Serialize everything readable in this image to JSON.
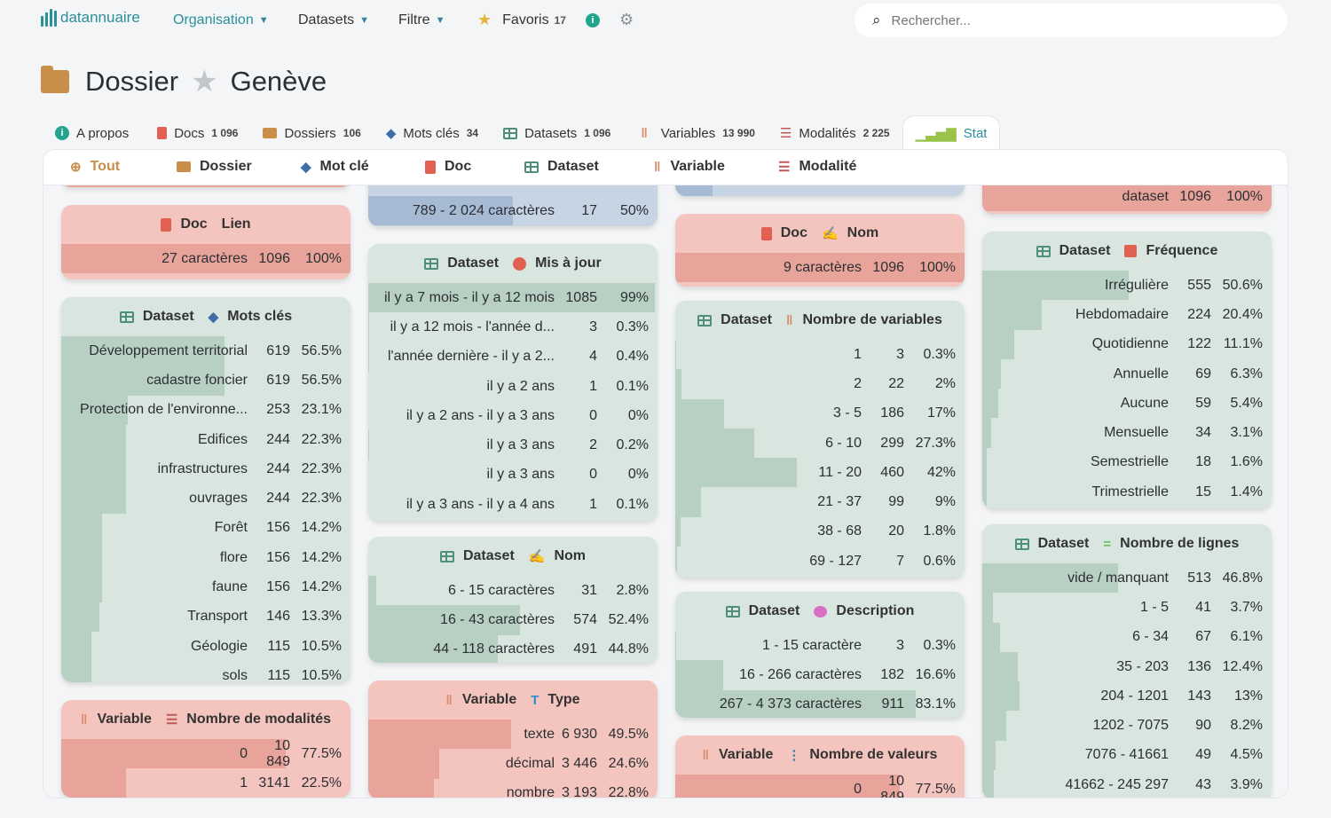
{
  "header": {
    "logo": "datannuaire",
    "nav": [
      {
        "label": "Organisation",
        "active": true
      },
      {
        "label": "Datasets",
        "active": false
      },
      {
        "label": "Filtre",
        "active": false
      }
    ],
    "favoris_label": "Favoris",
    "favoris_count": "17",
    "search_placeholder": "Rechercher..."
  },
  "title": {
    "kind": "Dossier",
    "name": "Genève"
  },
  "tabs": [
    {
      "label": "A propos",
      "count": ""
    },
    {
      "label": "Docs",
      "count": "1 096"
    },
    {
      "label": "Dossiers",
      "count": "106"
    },
    {
      "label": "Mots clés",
      "count": "34"
    },
    {
      "label": "Datasets",
      "count": "1 096"
    },
    {
      "label": "Variables",
      "count": "13 990"
    },
    {
      "label": "Modalités",
      "count": "2 225"
    },
    {
      "label": "Stat",
      "count": ""
    }
  ],
  "filters": [
    "Tout",
    "Dossier",
    "Mot clé",
    "Doc",
    "Dataset",
    "Variable",
    "Modalité"
  ],
  "cards": {
    "c1_top": {
      "rows": [
        {
          "l": "",
          "c": "",
          "p": "",
          "f": 1.0
        }
      ]
    },
    "c1_lien": {
      "h1": "Doc",
      "h2": "Lien",
      "rows": [
        {
          "l": "27 caractères",
          "c": "1096",
          "p": "100%",
          "f": 1.0
        }
      ]
    },
    "c1_mots": {
      "h1": "Dataset",
      "h2": "Mots clés",
      "rows": [
        {
          "l": "Développement territorial",
          "c": "619",
          "p": "56.5%",
          "f": 0.565
        },
        {
          "l": "cadastre foncier",
          "c": "619",
          "p": "56.5%",
          "f": 0.565
        },
        {
          "l": "Protection de l'environne...",
          "c": "253",
          "p": "23.1%",
          "f": 0.231
        },
        {
          "l": "Edifices",
          "c": "244",
          "p": "22.3%",
          "f": 0.223
        },
        {
          "l": "infrastructures",
          "c": "244",
          "p": "22.3%",
          "f": 0.223
        },
        {
          "l": "ouvrages",
          "c": "244",
          "p": "22.3%",
          "f": 0.223
        },
        {
          "l": "Forêt",
          "c": "156",
          "p": "14.2%",
          "f": 0.142
        },
        {
          "l": "flore",
          "c": "156",
          "p": "14.2%",
          "f": 0.142
        },
        {
          "l": "faune",
          "c": "156",
          "p": "14.2%",
          "f": 0.142
        },
        {
          "l": "Transport",
          "c": "146",
          "p": "13.3%",
          "f": 0.133
        },
        {
          "l": "Géologie",
          "c": "115",
          "p": "10.5%",
          "f": 0.105
        },
        {
          "l": "sols",
          "c": "115",
          "p": "10.5%",
          "f": 0.105
        }
      ]
    },
    "c1_nbmod": {
      "h1": "Variable",
      "h2": "Nombre de modalités",
      "rows": [
        {
          "l": "0",
          "c": "10 849",
          "p": "77.5%",
          "f": 0.775
        },
        {
          "l": "1",
          "c": "3141",
          "p": "22.5%",
          "f": 0.225
        }
      ]
    },
    "c2_top": {
      "rows": [
        {
          "l": "789 - 2 024 caractères",
          "c": "17",
          "p": "50%",
          "f": 0.5
        }
      ]
    },
    "c2_maj": {
      "h1": "Dataset",
      "h2": "Mis à jour",
      "rows": [
        {
          "l": "il y a 7 mois - il y a 12 mois",
          "c": "1085",
          "p": "99%",
          "f": 0.99
        },
        {
          "l": "il y a 12 mois - l'année d...",
          "c": "3",
          "p": "0.3%",
          "f": 0.003
        },
        {
          "l": "l'année dernière - il y a 2...",
          "c": "4",
          "p": "0.4%",
          "f": 0.004
        },
        {
          "l": "il y a 2 ans",
          "c": "1",
          "p": "0.1%",
          "f": 0.001
        },
        {
          "l": "il y a 2 ans - il y a 3 ans",
          "c": "0",
          "p": "0%",
          "f": 0
        },
        {
          "l": "il y a 3 ans",
          "c": "2",
          "p": "0.2%",
          "f": 0.002
        },
        {
          "l": "il y a 3 ans",
          "c": "0",
          "p": "0%",
          "f": 0
        },
        {
          "l": "il y a 3 ans - il y a 4 ans",
          "c": "1",
          "p": "0.1%",
          "f": 0.001
        }
      ]
    },
    "c2_nom": {
      "h1": "Dataset",
      "h2": "Nom",
      "rows": [
        {
          "l": "6 - 15 caractères",
          "c": "31",
          "p": "2.8%",
          "f": 0.028
        },
        {
          "l": "16 - 43 caractères",
          "c": "574",
          "p": "52.4%",
          "f": 0.524
        },
        {
          "l": "44 - 118 caractères",
          "c": "491",
          "p": "44.8%",
          "f": 0.448
        }
      ]
    },
    "c2_type": {
      "h1": "Variable",
      "h2": "Type",
      "rows": [
        {
          "l": "texte",
          "c": "6 930",
          "p": "49.5%",
          "f": 0.495
        },
        {
          "l": "décimal",
          "c": "3 446",
          "p": "24.6%",
          "f": 0.246
        },
        {
          "l": "nombre",
          "c": "3 193",
          "p": "22.8%",
          "f": 0.228
        }
      ]
    },
    "c3_top": {
      "rows": [
        {
          "l": "",
          "c": "",
          "p": "",
          "f": 0.13
        }
      ]
    },
    "c3_nom": {
      "h1": "Doc",
      "h2": "Nom",
      "rows": [
        {
          "l": "9 caractères",
          "c": "1096",
          "p": "100%",
          "f": 1.0
        }
      ]
    },
    "c3_nbvar": {
      "h1": "Dataset",
      "h2": "Nombre de variables",
      "rows": [
        {
          "l": "1",
          "c": "3",
          "p": "0.3%",
          "f": 0.003
        },
        {
          "l": "2",
          "c": "22",
          "p": "2%",
          "f": 0.02
        },
        {
          "l": "3 - 5",
          "c": "186",
          "p": "17%",
          "f": 0.17
        },
        {
          "l": "6 - 10",
          "c": "299",
          "p": "27.3%",
          "f": 0.273
        },
        {
          "l": "11 - 20",
          "c": "460",
          "p": "42%",
          "f": 0.42
        },
        {
          "l": "21 - 37",
          "c": "99",
          "p": "9%",
          "f": 0.09
        },
        {
          "l": "38 - 68",
          "c": "20",
          "p": "1.8%",
          "f": 0.018
        },
        {
          "l": "69 - 127",
          "c": "7",
          "p": "0.6%",
          "f": 0.006
        }
      ]
    },
    "c3_desc": {
      "h1": "Dataset",
      "h2": "Description",
      "rows": [
        {
          "l": "1 - 15 caractère",
          "c": "3",
          "p": "0.3%",
          "f": 0.003
        },
        {
          "l": "16 - 266 caractères",
          "c": "182",
          "p": "16.6%",
          "f": 0.166
        },
        {
          "l": "267 - 4 373 caractères",
          "c": "911",
          "p": "83.1%",
          "f": 0.831
        }
      ]
    },
    "c3_nbval": {
      "h1": "Variable",
      "h2": "Nombre de valeurs",
      "rows": [
        {
          "l": "0",
          "c": "10 849",
          "p": "77.5%",
          "f": 0.775
        }
      ]
    },
    "c4_top": {
      "rows": [
        {
          "l": "dataset",
          "c": "1096",
          "p": "100%",
          "f": 1.0
        }
      ]
    },
    "c4_freq": {
      "h1": "Dataset",
      "h2": "Fréquence",
      "rows": [
        {
          "l": "Irrégulière",
          "c": "555",
          "p": "50.6%",
          "f": 0.506
        },
        {
          "l": "Hebdomadaire",
          "c": "224",
          "p": "20.4%",
          "f": 0.204
        },
        {
          "l": "Quotidienne",
          "c": "122",
          "p": "11.1%",
          "f": 0.111
        },
        {
          "l": "Annuelle",
          "c": "69",
          "p": "6.3%",
          "f": 0.063
        },
        {
          "l": "Aucune",
          "c": "59",
          "p": "5.4%",
          "f": 0.054
        },
        {
          "l": "Mensuelle",
          "c": "34",
          "p": "3.1%",
          "f": 0.031
        },
        {
          "l": "Semestrielle",
          "c": "18",
          "p": "1.6%",
          "f": 0.016
        },
        {
          "l": "Trimestrielle",
          "c": "15",
          "p": "1.4%",
          "f": 0.014
        }
      ]
    },
    "c4_lignes": {
      "h1": "Dataset",
      "h2": "Nombre de lignes",
      "rows": [
        {
          "l": "vide / manquant",
          "c": "513",
          "p": "46.8%",
          "f": 0.468
        },
        {
          "l": "1 - 5",
          "c": "41",
          "p": "3.7%",
          "f": 0.037
        },
        {
          "l": "6 - 34",
          "c": "67",
          "p": "6.1%",
          "f": 0.061
        },
        {
          "l": "35 - 203",
          "c": "136",
          "p": "12.4%",
          "f": 0.124
        },
        {
          "l": "204 - 1201",
          "c": "143",
          "p": "13%",
          "f": 0.13
        },
        {
          "l": "1202 - 7075",
          "c": "90",
          "p": "8.2%",
          "f": 0.082
        },
        {
          "l": "7076 - 41661",
          "c": "49",
          "p": "4.5%",
          "f": 0.045
        },
        {
          "l": "41662 - 245 297",
          "c": "43",
          "p": "3.9%",
          "f": 0.039
        }
      ]
    }
  },
  "colors": {
    "accent": "#2a8f9a",
    "dataset_green": "#d8e6df",
    "doc_red": "#f4c5be",
    "blue": "#c6d4e3"
  }
}
